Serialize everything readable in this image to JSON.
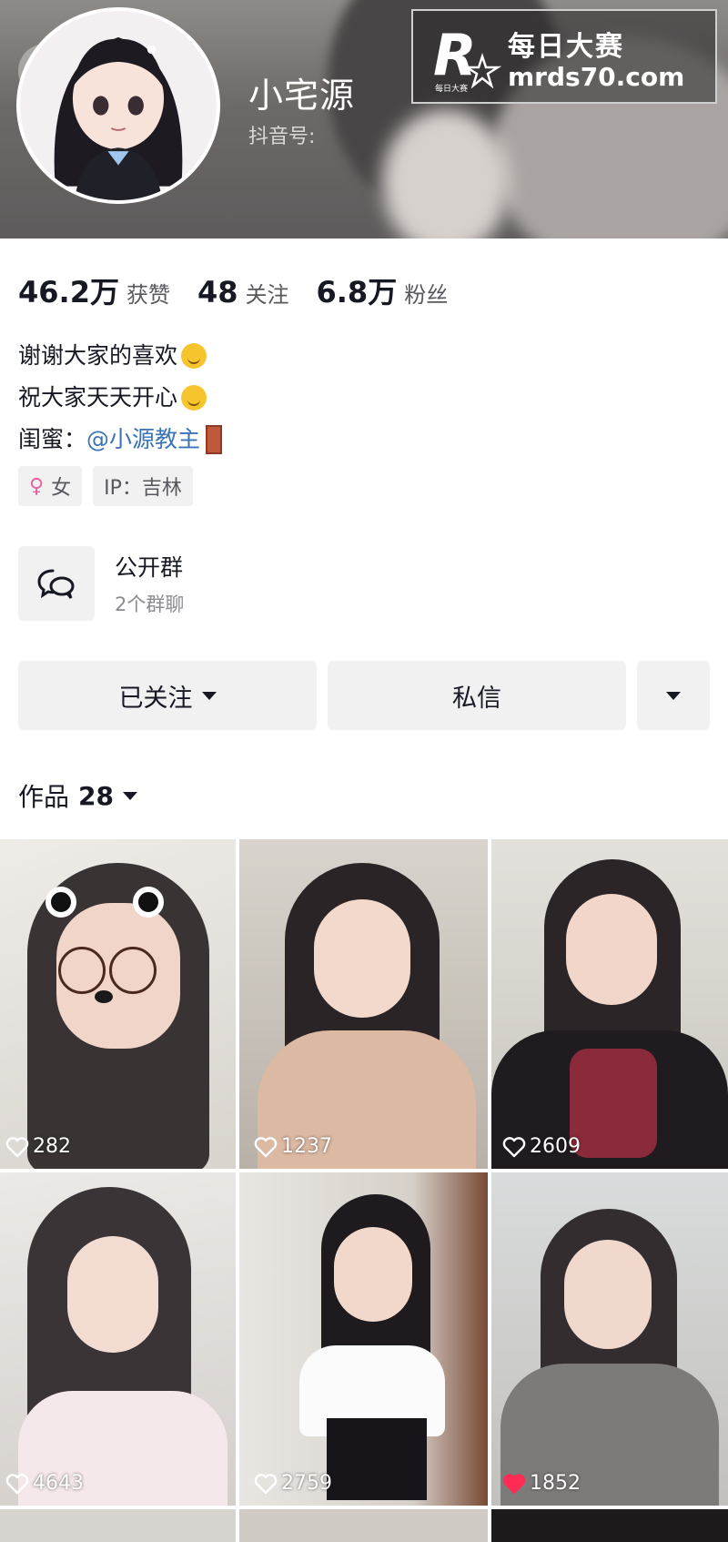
{
  "profile": {
    "nickname": "小宅源",
    "douyin_id_label": "抖音号:"
  },
  "watermark": {
    "title": "每日大赛",
    "url": "mrds70.com",
    "logo_letter": "R",
    "logo_small": "每日大赛"
  },
  "stats": [
    {
      "value": "46.2万",
      "label": "获赞"
    },
    {
      "value": "48",
      "label": "关注"
    },
    {
      "value": "6.8万",
      "label": "粉丝"
    }
  ],
  "bio": {
    "line1": "谢谢大家的喜欢",
    "line2": "祝大家天天开心",
    "line3_prefix": "闺蜜：",
    "line3_mention": "@小源教主"
  },
  "tags": {
    "gender": "女",
    "ip": "IP：吉林"
  },
  "group": {
    "title": "公开群",
    "subtitle": "2个群聊"
  },
  "actions": {
    "follow_label": "已关注",
    "message_label": "私信"
  },
  "works": {
    "label": "作品",
    "count": "28",
    "items": [
      {
        "likes": "282",
        "liked": false
      },
      {
        "likes": "1237",
        "liked": false
      },
      {
        "likes": "2609",
        "liked": false
      },
      {
        "likes": "4643",
        "liked": false
      },
      {
        "likes": "2759",
        "liked": false
      },
      {
        "likes": "1852",
        "liked": true
      }
    ]
  },
  "colors": {
    "like_active": "#fe2c55",
    "mention": "#3b73b8",
    "button_bg": "#f1f1f2"
  }
}
